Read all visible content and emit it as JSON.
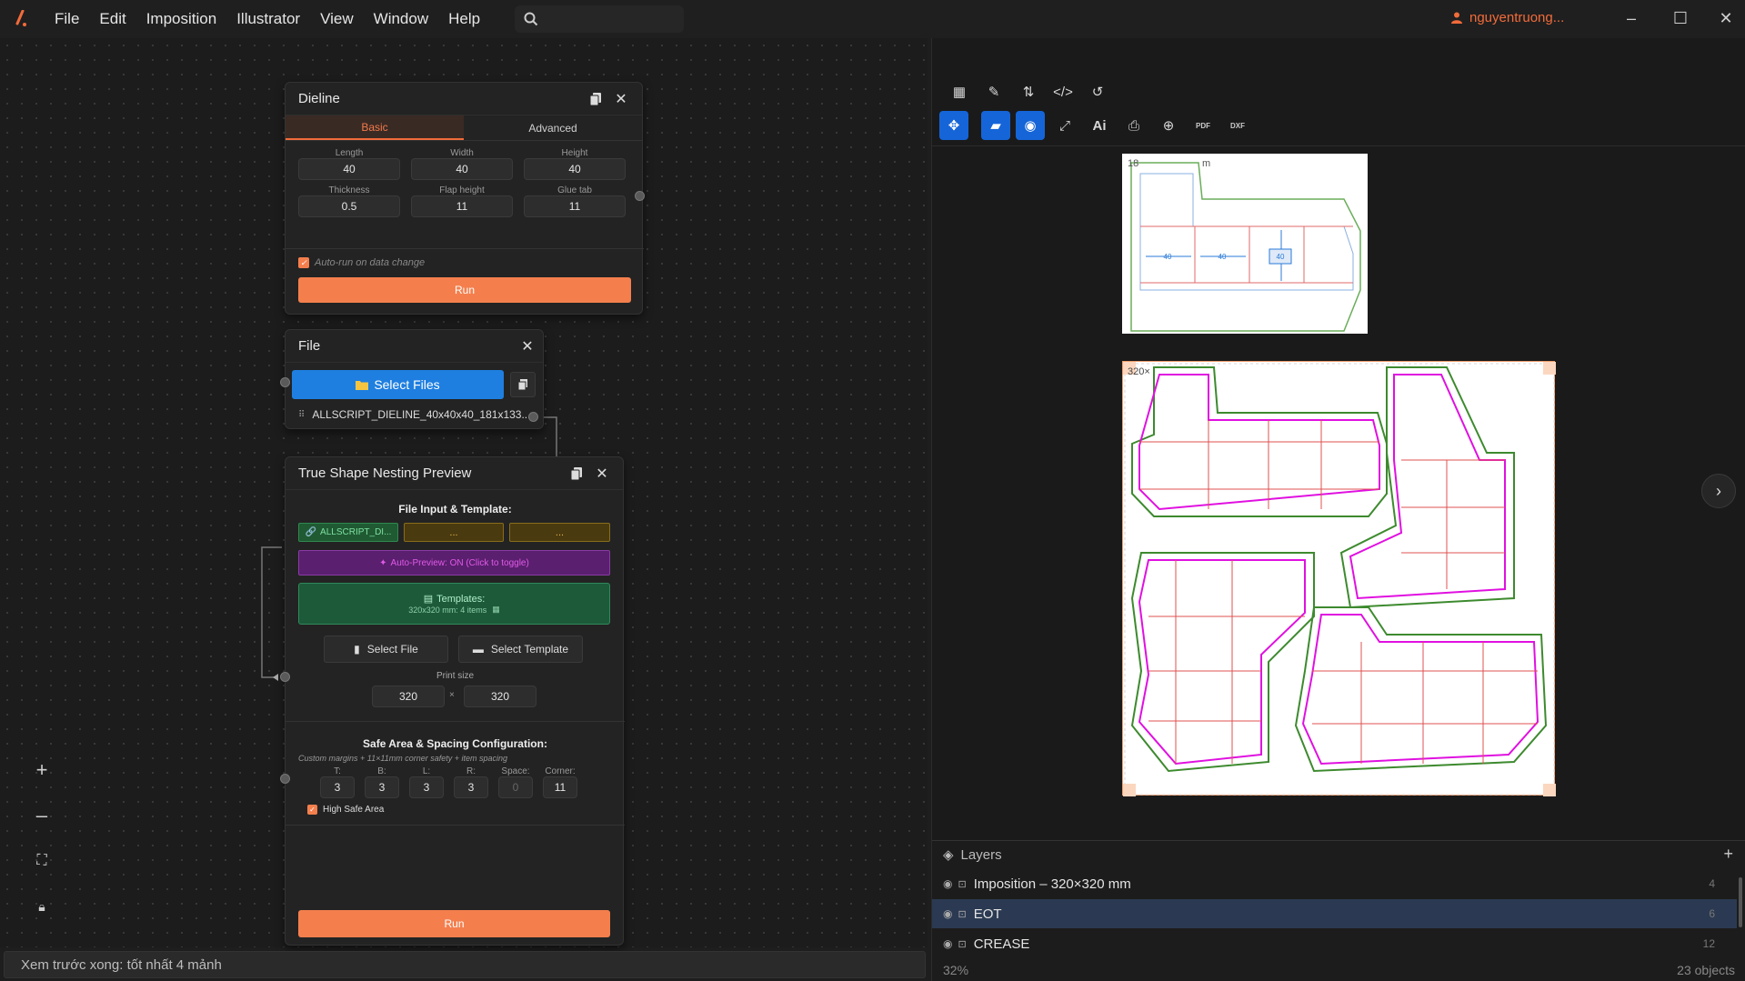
{
  "menu": {
    "items": [
      "File",
      "Edit",
      "Imposition",
      "Illustrator",
      "View",
      "Window",
      "Help"
    ],
    "user": "nguyentruong...",
    "accent": "#f26b3a"
  },
  "dieline": {
    "title": "Dieline",
    "tabs": [
      "Basic",
      "Advanced"
    ],
    "fields": [
      {
        "label": "Length",
        "value": "40"
      },
      {
        "label": "Width",
        "value": "40"
      },
      {
        "label": "Height",
        "value": "40"
      },
      {
        "label": "Thickness",
        "value": "0.5"
      },
      {
        "label": "Flap height",
        "value": "11"
      },
      {
        "label": "Glue tab",
        "value": "11"
      }
    ],
    "autorun": "Auto-run on data change",
    "run": "Run"
  },
  "file": {
    "title": "File",
    "select": "Select Files",
    "filename": "ALLSCRIPT_DIELINE_40x40x40_181x133..."
  },
  "nesting": {
    "title": "True Shape Nesting Preview",
    "input_heading": "File Input & Template:",
    "slot1": "ALLSCRIPT_DI...",
    "slot2": "...",
    "slot3": "...",
    "autopreview": "Auto-Preview: ON (Click to toggle)",
    "templates_title": "Templates:",
    "templates_info": "320x320 mm: 4 items",
    "select_file": "Select File",
    "select_template": "Select Template",
    "print_size_label": "Print size",
    "print_w": "320",
    "print_h": "320",
    "times": "×",
    "safe_heading": "Safe Area & Spacing Configuration:",
    "safe_sub": "Custom margins + 11×11mm corner safety + item spacing",
    "margins": [
      {
        "label": "T:",
        "value": "3"
      },
      {
        "label": "B:",
        "value": "3"
      },
      {
        "label": "L:",
        "value": "3"
      },
      {
        "label": "R:",
        "value": "3"
      },
      {
        "label": "Space:",
        "value": "0"
      },
      {
        "label": "Corner:",
        "value": "11"
      }
    ],
    "high_safe": "High Safe Area",
    "run": "Run"
  },
  "status": "Xem trước xong: tốt nhất 4 mảnh",
  "preview": {
    "top_label": "18",
    "top_label_m": "m",
    "sheet_label": "320×",
    "dims": [
      "40",
      "40",
      "40"
    ]
  },
  "layers": {
    "title": "Layers",
    "rows": [
      {
        "name": "Imposition – 320×320 mm",
        "count": "4"
      },
      {
        "name": "EOT",
        "count": "6"
      },
      {
        "name": "CREASE",
        "count": "12"
      }
    ]
  },
  "footer": {
    "zoom": "32%",
    "objects": "23 objects"
  }
}
